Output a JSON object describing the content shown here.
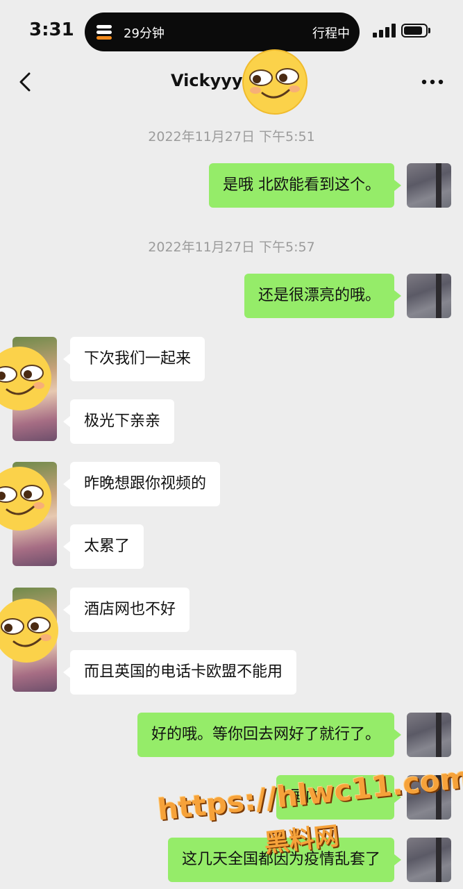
{
  "status_bar": {
    "time": "3:31",
    "island_left": "29分钟",
    "island_right": "行程中"
  },
  "nav": {
    "title": "Vickyyy"
  },
  "messages": [
    {
      "type": "timestamp",
      "text": "2022年11月27日 下午5:51"
    },
    {
      "type": "bubble",
      "from": "me",
      "text": "是哦 北欧能看到这个。"
    },
    {
      "type": "timestamp",
      "text": "2022年11月27日 下午5:57"
    },
    {
      "type": "bubble",
      "from": "me",
      "text": "还是很漂亮的哦。"
    },
    {
      "type": "bubble",
      "from": "them",
      "text": "下次我们一起来"
    },
    {
      "type": "bubble",
      "from": "them",
      "text": "极光下亲亲"
    },
    {
      "type": "bubble",
      "from": "them",
      "text": "昨晚想跟你视频的"
    },
    {
      "type": "bubble",
      "from": "them",
      "text": "太累了"
    },
    {
      "type": "bubble",
      "from": "them",
      "text": "酒店网也不好"
    },
    {
      "type": "bubble",
      "from": "them",
      "text": "而且英国的电话卡欧盟不能用"
    },
    {
      "type": "bubble",
      "from": "me",
      "text": "好的哦。等你回去网好了就行了。"
    },
    {
      "type": "bubble",
      "from": "me",
      "text": "国内"
    },
    {
      "type": "bubble",
      "from": "me",
      "text": "这几天全国都因为疫情乱套了"
    }
  ],
  "watermark": {
    "url": "https://hlwc11.com",
    "name": "黑料网"
  },
  "colors": {
    "background": "#ededed",
    "bubble_me": "#95ec69",
    "bubble_them": "#ffffff",
    "timestamp": "#9b9b9b",
    "watermark": "#f6a23a"
  }
}
